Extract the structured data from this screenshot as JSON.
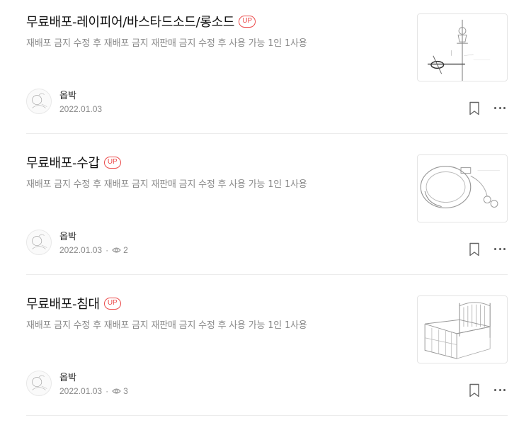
{
  "posts": [
    {
      "title": "무료배포-레이피어/바스타드소드/롱소드",
      "badge": "UP",
      "description": "재배포 금지 수정 후 재배포 금지 재판매 금지 수정 후 사용 가능 1인 1사용",
      "author": "옵박",
      "date": "2022.01.03",
      "dot": "",
      "views": "",
      "thumbnail_icon": "sword-sketch-icon"
    },
    {
      "title": "무료배포-수갑",
      "badge": "UP",
      "description": "재배포 금지 수정 후 재배포 금지 재판매 금지 수정 후 사용 가능 1인 1사용",
      "author": "옵박",
      "date": "2022.01.03",
      "dot": "·",
      "views": "2",
      "thumbnail_icon": "handcuffs-sketch-icon"
    },
    {
      "title": "무료배포-침대",
      "badge": "UP",
      "description": "재배포 금지 수정 후 재배포 금지 재판매 금지 수정 후 사용 가능 1인 1사용",
      "author": "옵박",
      "date": "2022.01.03",
      "dot": "·",
      "views": "3",
      "thumbnail_icon": "bed-sketch-icon"
    }
  ],
  "colors": {
    "badge": "#eb4b4b",
    "muted_text": "#888888",
    "divider": "#ececec"
  }
}
